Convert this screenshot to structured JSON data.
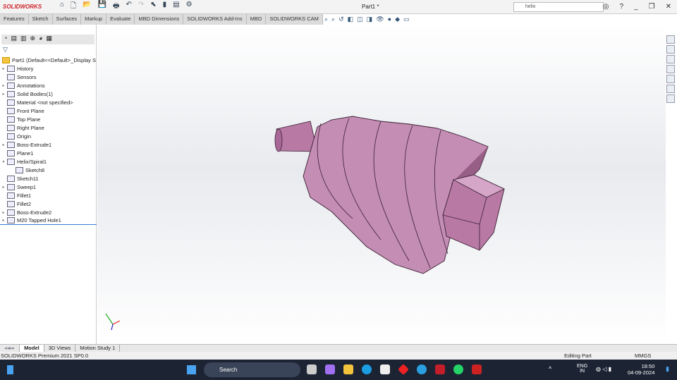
{
  "app": {
    "logo": "SOLIDWORKS",
    "document_title": "Part1 *",
    "search_value": "helix"
  },
  "command_tabs": [
    "Features",
    "Sketch",
    "Surfaces",
    "Markup",
    "Evaluate",
    "MBD Dimensions",
    "SOLIDWORKS Add-Ins",
    "MBD",
    "SOLIDWORKS CAM"
  ],
  "tree": {
    "root": "Part1  (Default<<Default>_Display S",
    "items": [
      {
        "label": "History",
        "expand": "▸"
      },
      {
        "label": "Sensors",
        "expand": ""
      },
      {
        "label": "Annotations",
        "expand": "▸"
      },
      {
        "label": "Solid Bodies(1)",
        "expand": "▸"
      },
      {
        "label": "Material <not specified>",
        "expand": ""
      },
      {
        "label": "Front Plane",
        "expand": ""
      },
      {
        "label": "Top Plane",
        "expand": ""
      },
      {
        "label": "Right Plane",
        "expand": ""
      },
      {
        "label": "Origin",
        "expand": ""
      },
      {
        "label": "Boss-Extrude1",
        "expand": "▸"
      },
      {
        "label": "Plane1",
        "expand": ""
      },
      {
        "label": "Helix/Spiral1",
        "expand": "▾"
      },
      {
        "label": "Sketch8",
        "expand": "",
        "indent": true
      },
      {
        "label": "Sketch11",
        "expand": ""
      },
      {
        "label": "Sweep1",
        "expand": "▸"
      },
      {
        "label": "Fillet1",
        "expand": ""
      },
      {
        "label": "Fillet2",
        "expand": ""
      },
      {
        "label": "Boss-Extrude2",
        "expand": "▸"
      },
      {
        "label": "M20 Tapped Hole1",
        "expand": "▸"
      }
    ]
  },
  "bottom_tabs": [
    "Model",
    "3D Views",
    "Motion Study 1"
  ],
  "status": {
    "left": "SOLIDWORKS Premium 2021 SP0.0",
    "center": "Editing Part",
    "units": "MMGS"
  },
  "taskbar": {
    "search": "Search",
    "lang1": "ENG",
    "lang2": "IN",
    "time": "18:50",
    "date": "04-09-2024"
  },
  "colors": {
    "model": "#b87aa5",
    "model_dark": "#7a4068"
  }
}
